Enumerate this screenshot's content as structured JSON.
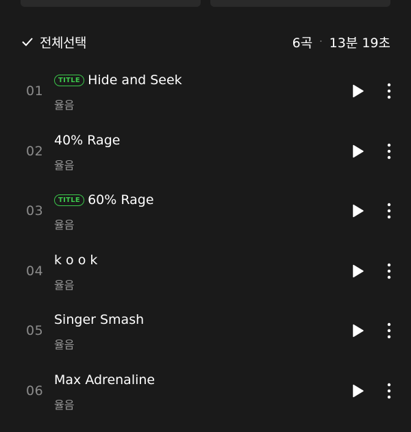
{
  "header": {
    "select_all_label": "전체선택",
    "track_count": "6곡",
    "separator": "·",
    "total_duration": "13분 19초"
  },
  "tracks": [
    {
      "number": "01",
      "title": "Hide and Seek",
      "artist": "율음",
      "badge": "TITLE"
    },
    {
      "number": "02",
      "title": "40% Rage",
      "artist": "율음",
      "badge": ""
    },
    {
      "number": "03",
      "title": "60% Rage",
      "artist": "율음",
      "badge": "TITLE"
    },
    {
      "number": "04",
      "title": "k o o k",
      "artist": "율음",
      "badge": ""
    },
    {
      "number": "05",
      "title": "Singer Smash",
      "artist": "율음",
      "badge": ""
    },
    {
      "number": "06",
      "title": "Max Adrenaline",
      "artist": "율음",
      "badge": ""
    }
  ],
  "icons": {
    "check": "check-icon",
    "play": "play-icon",
    "more": "more-vertical-icon"
  },
  "colors": {
    "background": "#1a1a1a",
    "badge": "#3cc84b",
    "text": "#ffffff",
    "muted": "#9a9a9a"
  }
}
